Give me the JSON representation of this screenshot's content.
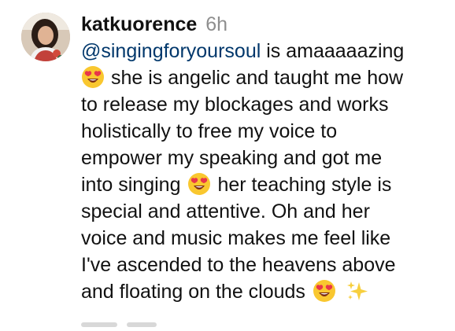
{
  "comment": {
    "username": "katkuorence",
    "timestamp": "6h",
    "mention": "@singingforyoursoul",
    "lines": {
      "l1_rest": " is amaaaaazing",
      "l2_after_emoji": "she is angelic and taught me how",
      "l3": "to release my blockages and works",
      "l4": "holistically to free my voice to",
      "l5": "empower my speaking and got me",
      "l6_before_emoji": "into singing",
      "l6_after_emoji": "her teaching style is",
      "l7": "special and attentive. Oh and her",
      "l8": "voice and music makes me feel like",
      "l9": "I've ascended to the heavens above",
      "l10_before_emoji": "and floating on the clouds"
    },
    "emoji_name": "heart-eyes-emoji",
    "sparkles_name": "sparkles-icon",
    "avatar_name": "avatar"
  }
}
